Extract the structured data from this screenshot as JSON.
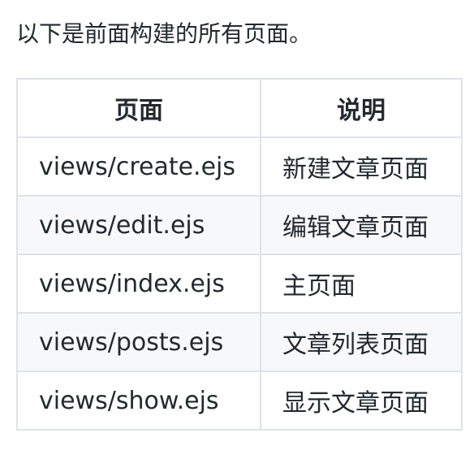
{
  "intro": "以下是前面构建的所有页面。",
  "table": {
    "headers": [
      "页面",
      "说明"
    ],
    "rows": [
      {
        "page": "views/create.ejs",
        "desc": "新建文章页面"
      },
      {
        "page": "views/edit.ejs",
        "desc": "编辑文章页面"
      },
      {
        "page": "views/index.ejs",
        "desc": "主页面"
      },
      {
        "page": "views/posts.ejs",
        "desc": "文章列表页面"
      },
      {
        "page": "views/show.ejs",
        "desc": "显示文章页面"
      }
    ]
  },
  "colors": {
    "border": "#dfe2e5",
    "stripe": "#f6f8fa",
    "text": "#24292e"
  }
}
